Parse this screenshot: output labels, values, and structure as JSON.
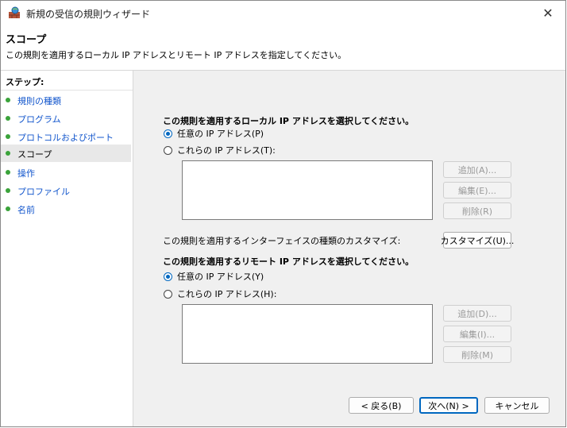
{
  "window": {
    "title": "新規の受信の規則ウィザード",
    "close_glyph": "✕"
  },
  "header": {
    "title": "スコープ",
    "description": "この規則を適用するローカル IP アドレスとリモート IP アドレスを指定してください。"
  },
  "steps": {
    "label": "ステップ:",
    "items": [
      {
        "label": "規則の種類"
      },
      {
        "label": "プログラム"
      },
      {
        "label": "プロトコルおよびポート"
      },
      {
        "label": "スコープ"
      },
      {
        "label": "操作"
      },
      {
        "label": "プロファイル"
      },
      {
        "label": "名前"
      }
    ]
  },
  "local": {
    "heading": "この規則を適用するローカル IP アドレスを選択してください。",
    "option_any": "任意の IP アドレス(P)",
    "option_these": "これらの IP アドレス(T):",
    "add": "追加(A)...",
    "edit": "編集(E)...",
    "remove": "削除(R)"
  },
  "interface": {
    "label": "この規則を適用するインターフェイスの種類のカスタマイズ:",
    "customize": "カスタマイズ(U)..."
  },
  "remote": {
    "heading": "この規則を適用するリモート IP アドレスを選択してください。",
    "option_any": "任意の IP アドレス(Y)",
    "option_these": "これらの IP アドレス(H):",
    "add": "追加(D)...",
    "edit": "編集(I)...",
    "remove": "削除(M)"
  },
  "footer": {
    "back": "< 戻る(B)",
    "next": "次へ(N) >",
    "cancel": "キャンセル"
  },
  "colors": {
    "accent": "#0067c0",
    "step_dot": "#3aa33a",
    "link": "#1155cc"
  },
  "icons": {
    "app": "firewall-wizard-icon",
    "close": "close-icon"
  }
}
